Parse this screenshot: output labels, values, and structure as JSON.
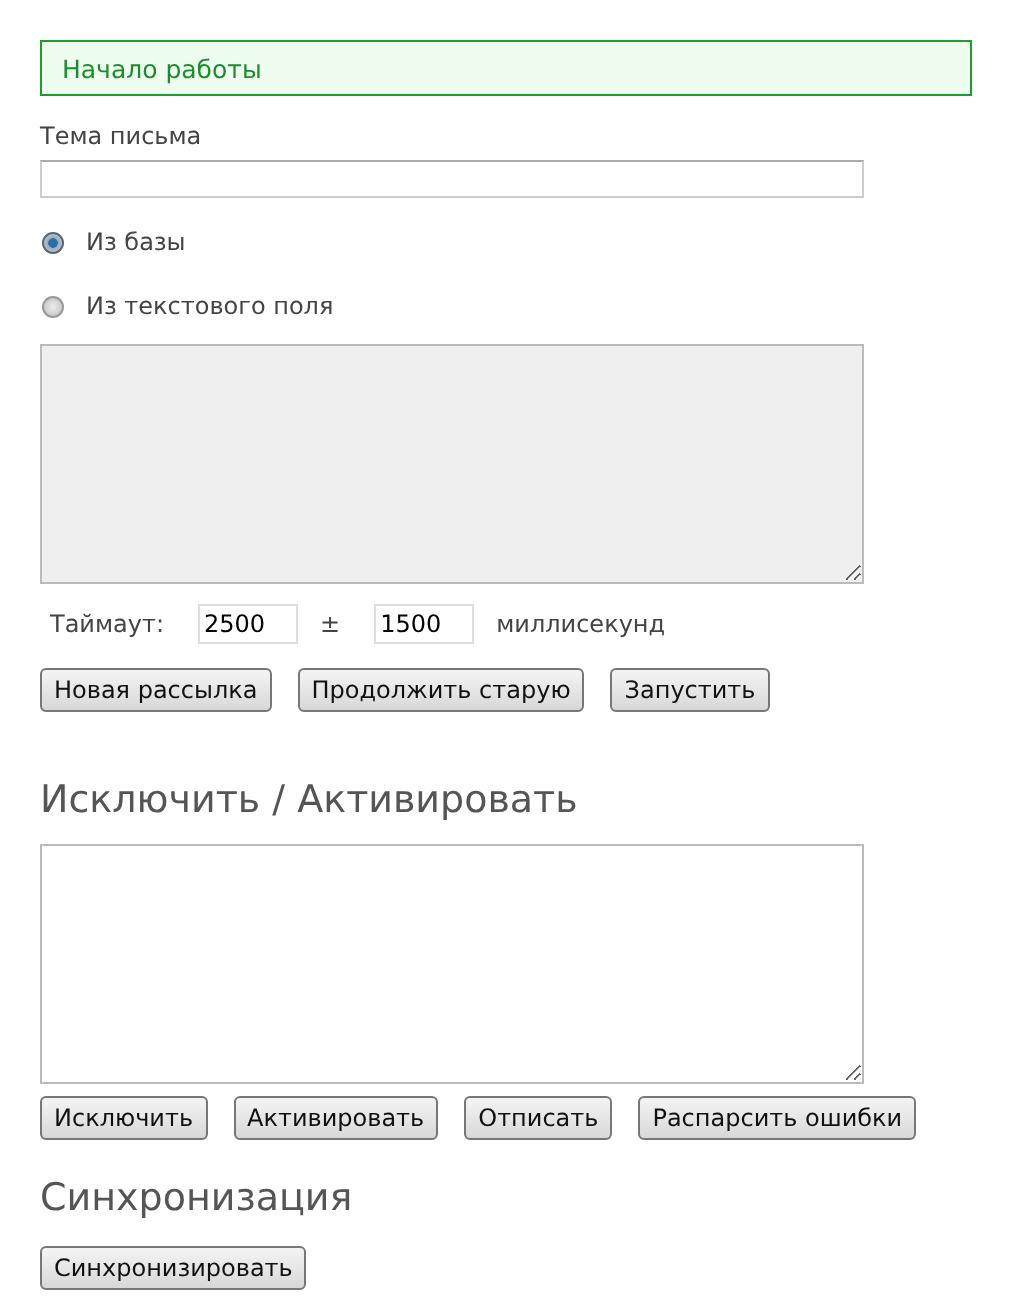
{
  "status_message": "Начало работы",
  "subject": {
    "label": "Тема письма"
  },
  "source_options": [
    {
      "label": "Из базы",
      "selected": true
    },
    {
      "label": "Из текстового поля",
      "selected": false
    }
  ],
  "text_area": {
    "disabled": true
  },
  "timeout": {
    "label": "Таймаут:",
    "value": "2500",
    "sign": "±",
    "spread": "1500",
    "unit": "миллисекунд"
  },
  "mailing_buttons": [
    "Новая рассылка",
    "Продолжить старую",
    "Запустить"
  ],
  "exclude_section": {
    "title": "Исключить / Активировать",
    "buttons": [
      "Исключить",
      "Активировать",
      "Отписать",
      "Распарсить ошибки"
    ]
  },
  "sync_section": {
    "title": "Синхронизация",
    "buttons": [
      "Синхронизировать"
    ]
  }
}
